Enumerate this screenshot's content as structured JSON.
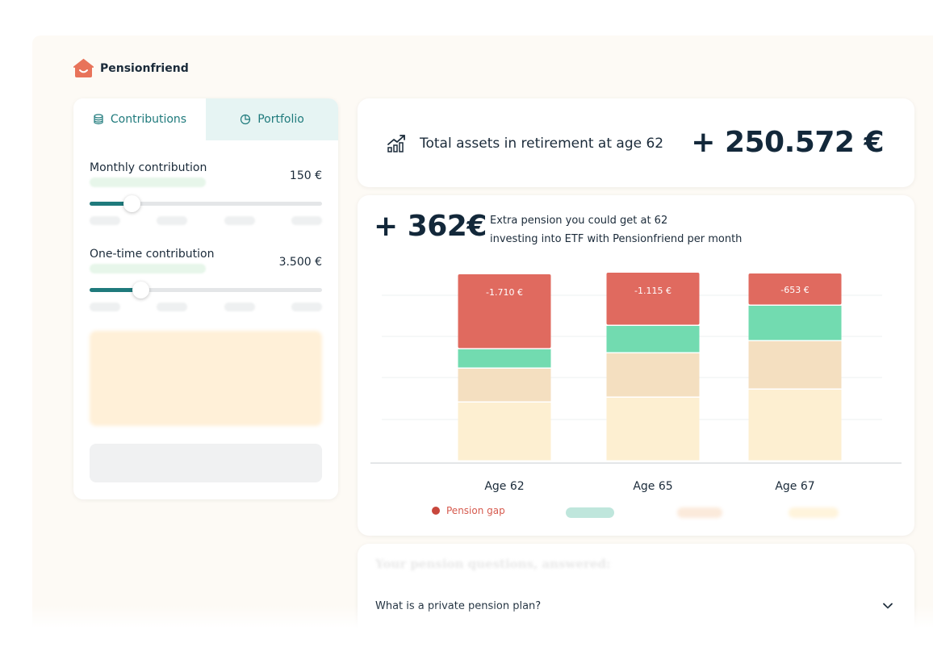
{
  "brand": {
    "name": "Pensionfriend",
    "accent": "#1f7a7c",
    "logo_color": "#e8735a"
  },
  "tabs": [
    {
      "label": "Contributions",
      "icon": "coins-icon",
      "active": true
    },
    {
      "label": "Portfolio",
      "icon": "pie-chart-icon",
      "active": false
    }
  ],
  "contributions": {
    "monthly": {
      "label": "Monthly  contribution",
      "value": "150 €",
      "slider_fraction": 0.18
    },
    "one_time": {
      "label": "One-time contribution",
      "value": "3.500 €",
      "slider_fraction": 0.22
    }
  },
  "total": {
    "icon": "trending-up-chart-icon",
    "label": "Total assets in retirement at age 62",
    "value": "+ 250.572 €"
  },
  "extra": {
    "value": "+ 362€",
    "line1": "Extra pension you could get at 62",
    "line2": "investing into ETF with Pensionfriend per month"
  },
  "chart_data": {
    "type": "bar",
    "stacked": true,
    "categories": [
      "Age 62",
      "Age 65",
      "Age 67"
    ],
    "series": [
      {
        "color": "#fdefd1",
        "values": [
          73,
          79,
          89
        ]
      },
      {
        "color": "#f4dfc0",
        "values": [
          42,
          55,
          60
        ]
      },
      {
        "color": "#72dbb0",
        "values": [
          24,
          34,
          44
        ]
      },
      {
        "name": "Pension gap",
        "color": "#e06a5f",
        "values": [
          93,
          66,
          40
        ],
        "labels": [
          "-1.710 €",
          "-1.115 €",
          "-653 €"
        ]
      }
    ],
    "grid": true,
    "legend": "bottom"
  },
  "legend": {
    "pension_gap": "Pension gap"
  },
  "faq": {
    "title": "Your pension questions, answered:",
    "question": "What is a private pension plan?"
  }
}
